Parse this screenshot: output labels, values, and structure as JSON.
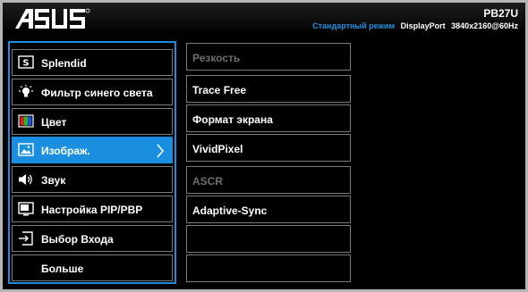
{
  "header": {
    "brand": "ASUS",
    "model": "PB27U",
    "mode": "Стандартный режим",
    "input_port": "DisplayPort",
    "resolution": "3840x2160@60Hz"
  },
  "main_menu": {
    "items": [
      {
        "label": "Splendid",
        "icon": "splendid-s-icon"
      },
      {
        "label": "Фильтр синего света",
        "icon": "bulb-icon"
      },
      {
        "label": "Цвет",
        "icon": "color-bars-icon"
      },
      {
        "label": "Изображ.",
        "icon": "image-icon",
        "selected": true
      },
      {
        "label": "Звук",
        "icon": "speaker-icon"
      },
      {
        "label": "Настройка PIP/PBP",
        "icon": "pip-icon"
      },
      {
        "label": "Выбор Входа",
        "icon": "input-select-icon"
      },
      {
        "label": "Больше",
        "icon": ""
      }
    ]
  },
  "sub_menu": {
    "items": [
      {
        "label": "Резкость",
        "enabled": false
      },
      {
        "label": "Trace Free",
        "enabled": true
      },
      {
        "label": "Формат экрана",
        "enabled": true
      },
      {
        "label": "VividPixel",
        "enabled": true
      },
      {
        "label": "ASCR",
        "enabled": false
      },
      {
        "label": "Adaptive-Sync",
        "enabled": true
      },
      {
        "label": "",
        "enabled": true
      },
      {
        "label": "",
        "enabled": true
      }
    ]
  },
  "colors": {
    "accent": "#1a8fe0",
    "mode_text": "#1e8fe0",
    "disabled_text": "#6f6f6f",
    "border": "#7a7a7a"
  }
}
